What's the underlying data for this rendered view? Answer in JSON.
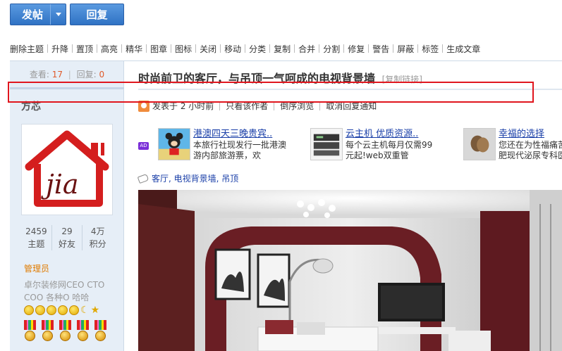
{
  "buttons": {
    "post": "发帖",
    "reply": "回复"
  },
  "toolbar": [
    "删除主题",
    "升降",
    "置顶",
    "高亮",
    "精华",
    "图章",
    "图标",
    "关闭",
    "移动",
    "分类",
    "复制",
    "合并",
    "分割",
    "修复",
    "警告",
    "屏蔽",
    "标签",
    "生成文章"
  ],
  "stats": {
    "views_label": "查看:",
    "views": "17",
    "replies_label": "回复:",
    "replies": "0"
  },
  "author": {
    "name": "方芯",
    "avatar_logo_text": "jia",
    "stats": [
      {
        "value": "2459",
        "label": "主题"
      },
      {
        "value": "29",
        "label": "好友"
      },
      {
        "value": "4万",
        "label": "积分"
      }
    ],
    "role": "管理员",
    "bio": "卓尔装修网CEO CTO COO 各种O 哈哈"
  },
  "post": {
    "title": "时尚前卫的客厅，与吊顶一气呵成的电视背景墙",
    "copy_link": "[复制链接]",
    "posted": "发表于 2 小时前",
    "only_author": "只看该作者",
    "reverse": "倒序浏览",
    "cancel_notify": "取消回复通知"
  },
  "ads": {
    "badge": "AD",
    "items": [
      {
        "title": "港澳四天三晚贵宾..",
        "desc1": "本旅行社现发行一批港澳",
        "desc2": "游内部旅游票，欢"
      },
      {
        "title": "云主机 优质资源..",
        "desc1": "每个云主机每月仅需99",
        "desc2": "元起!web双重管"
      },
      {
        "title": "幸福的选择",
        "desc1": "您还在为性福痛苦",
        "desc2": "肥现代泌尿专科医"
      }
    ]
  },
  "tags": "客厅, 电视背景墙, 吊顶",
  "colors": {
    "button": "#3a7fd0",
    "highlight": "#e0161e",
    "sidebar": "#e6eef7",
    "link": "#1a3fa8",
    "role": "#e07b00"
  }
}
